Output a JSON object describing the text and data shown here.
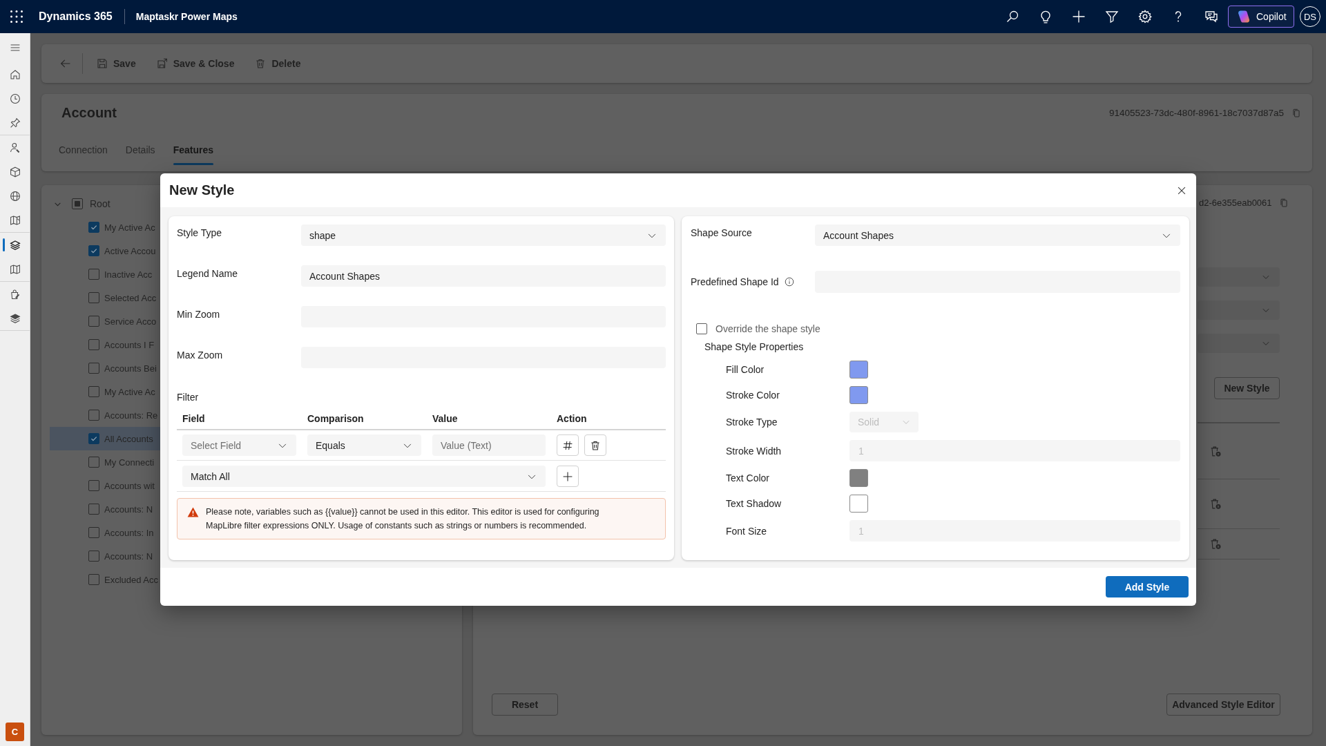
{
  "top_bar": {
    "app_name": "Dynamics 365",
    "module_name": "Maptaskr Power Maps",
    "copilot_label": "Copilot",
    "avatar_initials": "DS"
  },
  "nav_rail": {
    "items": [
      {
        "selected": false
      },
      {
        "selected": false
      },
      {
        "selected": false
      },
      {
        "selected": false
      },
      {
        "selected": false
      },
      {
        "selected": false
      },
      {
        "selected": false
      },
      {
        "selected": true
      },
      {
        "selected": false
      },
      {
        "selected": false
      },
      {
        "selected": false
      }
    ],
    "user_badge": "C"
  },
  "command_bar": {
    "buttons": [
      {
        "label": "Save"
      },
      {
        "label": "Save & Close"
      },
      {
        "label": "Delete"
      }
    ]
  },
  "record": {
    "title": "Account",
    "record_id": "91405523-73dc-480f-8961-18c7037d87a5",
    "tabs": [
      {
        "label": "Connection",
        "selected": false
      },
      {
        "label": "Details",
        "selected": false
      },
      {
        "label": "Features",
        "selected": true
      }
    ]
  },
  "layer_tree": {
    "root": {
      "label": "Root",
      "expanded": true,
      "indeterminate": true,
      "children": [
        {
          "label": "My Active Ac",
          "checked": true,
          "selected": false
        },
        {
          "label": "Active Accou",
          "checked": true,
          "selected": false
        },
        {
          "label": "Inactive Acc",
          "checked": false,
          "selected": false
        },
        {
          "label": "Selected Acc",
          "checked": false,
          "selected": false
        },
        {
          "label": "Service Acco",
          "checked": false,
          "selected": false
        },
        {
          "label": "Accounts I F",
          "checked": false,
          "selected": false
        },
        {
          "label": "Accounts Bei",
          "checked": false,
          "selected": false
        },
        {
          "label": "My Active Ac",
          "checked": false,
          "selected": false
        },
        {
          "label": "Accounts: Re",
          "checked": false,
          "selected": false
        },
        {
          "label": "All Accounts",
          "checked": true,
          "selected": true
        },
        {
          "label": "My Connecti",
          "checked": false,
          "selected": false
        },
        {
          "label": "Accounts wit",
          "checked": false,
          "selected": false
        },
        {
          "label": "Accounts: N",
          "checked": false,
          "selected": false
        },
        {
          "label": "Accounts: In",
          "checked": false,
          "selected": false
        },
        {
          "label": "Accounts: N",
          "checked": false,
          "selected": false
        },
        {
          "label": "Excluded Acc",
          "checked": false,
          "selected": false
        }
      ]
    }
  },
  "style_list": {
    "record_id_fragment": "d2-6e355eab0061",
    "new_style_button": "New Style",
    "reset_button": "Reset",
    "advanced_editor_button": "Advanced Style Editor"
  },
  "dialog": {
    "title": "New Style",
    "style_form": {
      "fields": [
        {
          "label": "Style Type",
          "kind": "dropdown",
          "value": "shape"
        },
        {
          "label": "Legend Name",
          "kind": "text",
          "value": "Account Shapes"
        },
        {
          "label": "Min Zoom",
          "kind": "text"
        },
        {
          "label": "Max Zoom",
          "kind": "text"
        }
      ]
    },
    "filter": {
      "label": "Filter",
      "columns": [
        "Field",
        "Comparison",
        "Value",
        "Action"
      ],
      "conditions": [
        {
          "field": {
            "placeholder": "Select Field"
          },
          "comparison": {
            "value": "Equals"
          },
          "value": {
            "placeholder": "Value (Text)"
          }
        }
      ],
      "combinator": {
        "value": "Match All"
      },
      "note": "Please note, variables such as {{value}} cannot be used in this editor. This editor is used for configuring MapLibre filter expressions ONLY. Usage of constants such as strings or numbers is recommended."
    },
    "shape_form": {
      "shape_source": {
        "label": "Shape Source",
        "value": "Account Shapes"
      },
      "predefined_shape_id": {
        "label": "Predefined Shape Id"
      },
      "override": {
        "label": "Override the shape style",
        "checked": false
      },
      "properties_heading": "Shape Style Properties",
      "properties": [
        {
          "label": "Fill Color",
          "kind": "color",
          "color": "#8099ef"
        },
        {
          "label": "Stroke Color",
          "kind": "color",
          "color": "#8099ef"
        },
        {
          "label": "Stroke Type",
          "kind": "select",
          "value": "Solid",
          "disabled": true
        },
        {
          "label": "Stroke Width",
          "kind": "number",
          "value": "1",
          "disabled": true
        },
        {
          "label": "Text Color",
          "kind": "color",
          "color": "#808080"
        },
        {
          "label": "Text Shadow",
          "kind": "color",
          "color": "#ffffff"
        },
        {
          "label": "Font Size",
          "kind": "number",
          "value": "1",
          "disabled": true
        }
      ]
    },
    "submit_button": "Add Style"
  }
}
